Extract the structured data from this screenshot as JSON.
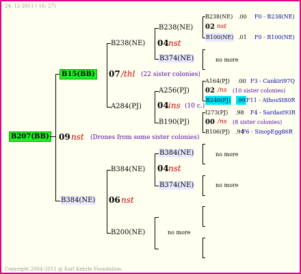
{
  "header": {
    "date": "24. 12-2011 ( 16: 27)"
  },
  "footer": {
    "copyright": "Copyright 2004-2011 @ Karl Kehrle Foundation."
  },
  "tree": {
    "root": {
      "label": "B207(BB)",
      "gen": "09",
      "mark": "nst",
      "note": "(Drones from some sister colonies)"
    },
    "b15": {
      "label": "B15(BB)",
      "gen": "07",
      "mark": "/thl",
      "note": "(22 sister colonies)"
    },
    "b384": {
      "label": "B384(NE)",
      "gen": "06",
      "mark": "nst"
    },
    "b238": {
      "label": "B238(NE)",
      "gen": "04",
      "mark": "nst"
    },
    "a284": {
      "label": "A284(PJ)",
      "gen": "04",
      "mark": "ins",
      "note": "(10 c.)"
    },
    "b384b": {
      "label": "B384(NE)",
      "gen": "04",
      "mark": "nst"
    },
    "b200": {
      "label": "B200(NE)",
      "more": "no more"
    },
    "b238b": {
      "label": "B238(NE)"
    },
    "b374": {
      "label": "B374(NE)",
      "more": "no more"
    },
    "a256": {
      "label": "A256(PJ)"
    },
    "b190": {
      "label": "B190(PJ)"
    },
    "b384c": {
      "label": "B384(NE)",
      "more": "no more"
    },
    "b374b": {
      "label": "B374(NE)",
      "more": "no more"
    }
  },
  "gen5": {
    "r1": {
      "label": "B238(NE)",
      "val": ".00",
      "info": "F0 - B238(NE)"
    },
    "r2": {
      "gen": "02",
      "mark": "nst"
    },
    "r3": {
      "label": "B100(NE)",
      "val": ".01",
      "info": "F0 - B100(NE)"
    },
    "r4": {
      "label": "A164(PJ)",
      "val": ".00",
      "info": "F3 - Cankiri97Q"
    },
    "r5": {
      "gen": "02",
      "mark": "/ns",
      "note": "(10 sister colonies)"
    },
    "r6": {
      "label": "B240(PJ)",
      "val": ".99",
      "info": "F11 - AthosSt80R"
    },
    "r7": {
      "label": "I273(PJ)",
      "val": ".98",
      "info": "F4 - Sardast93R"
    },
    "r8": {
      "gen": "00",
      "mark": "/ns",
      "note": "(8 sister colonies)"
    },
    "r9": {
      "label": "B106(PJ)",
      "val": ".94",
      "info": "F6 - SinopEgg86R"
    }
  }
}
